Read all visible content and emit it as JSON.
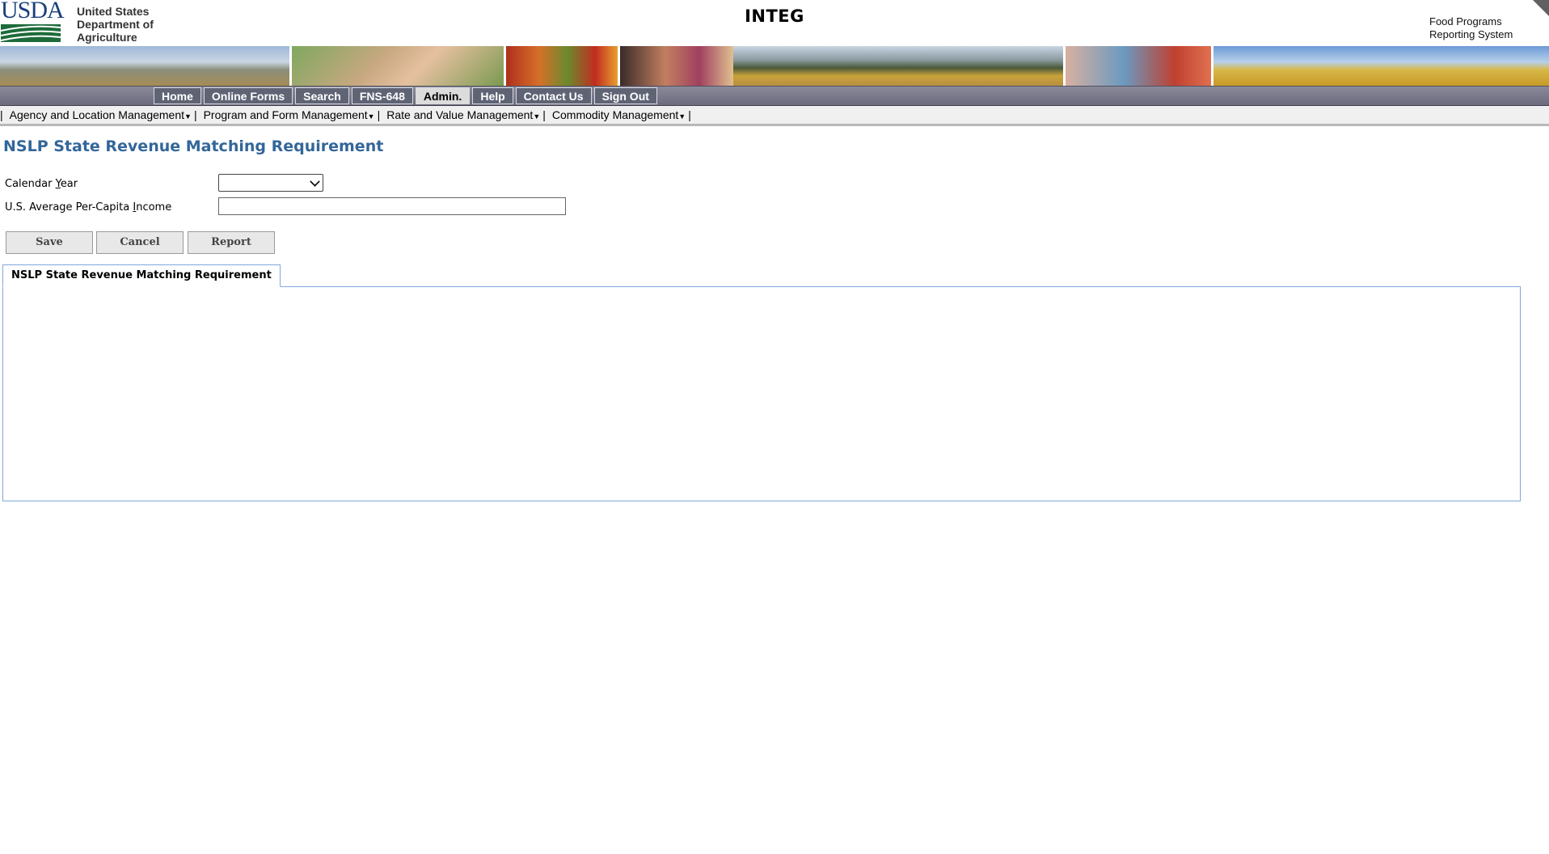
{
  "header": {
    "logo_text": "USDA",
    "department_lines": [
      "United States",
      "Department of",
      "Agriculture"
    ],
    "app_title": "INTEG",
    "system_lines": [
      "Food Programs",
      "Reporting System"
    ]
  },
  "nav": {
    "items": [
      {
        "label": "Home",
        "active": false
      },
      {
        "label": "Online Forms",
        "active": false
      },
      {
        "label": "Search",
        "active": false
      },
      {
        "label": "FNS-648",
        "active": false
      },
      {
        "label": "Admin.",
        "active": true
      },
      {
        "label": "Help",
        "active": false
      },
      {
        "label": "Contact Us",
        "active": false
      },
      {
        "label": "Sign Out",
        "active": false
      }
    ]
  },
  "subnav": {
    "items": [
      {
        "label": "Agency and Location Management"
      },
      {
        "label": "Program and Form Management"
      },
      {
        "label": "Rate and Value Management"
      },
      {
        "label": "Commodity Management"
      }
    ],
    "separator": "|"
  },
  "page": {
    "title": "NSLP State Revenue Matching Requirement"
  },
  "form": {
    "calendar_year_label_pre": "Calendar ",
    "calendar_year_label_key": "Y",
    "calendar_year_label_post": "ear",
    "calendar_year_value": "",
    "income_label_pre": "U.S. Average Per-Capita ",
    "income_label_key": "I",
    "income_label_post": "ncome",
    "income_value": ""
  },
  "buttons": {
    "save": "Save",
    "cancel": "Cancel",
    "report": "Report"
  },
  "tabs": [
    {
      "label": "NSLP State Revenue Matching Requirement",
      "active": true
    }
  ],
  "colors": {
    "title": "#336699",
    "nav_bg": "#6b6b7e",
    "tab_border": "#7fa8dc"
  }
}
